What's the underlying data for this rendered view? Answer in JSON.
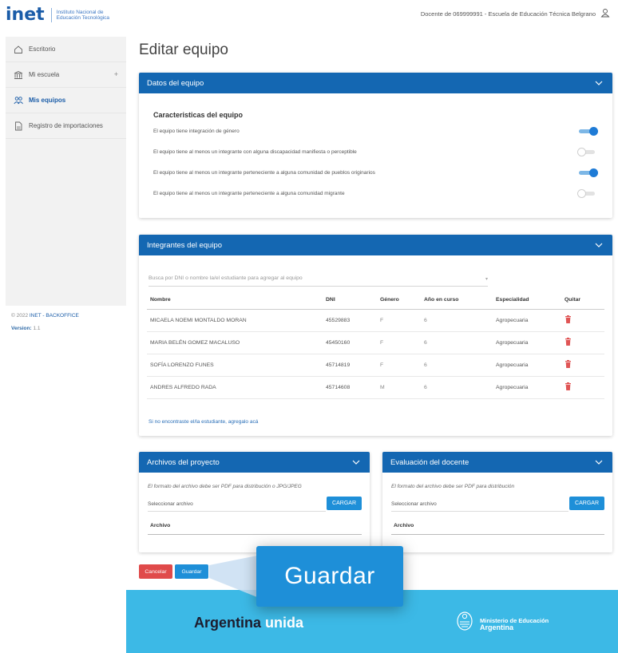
{
  "header": {
    "logo_word": "inet",
    "logo_sub_line1": "Instituto Nacional de",
    "logo_sub_line2": "Educación Tecnológica",
    "user_text": "Docente de 069999991 - Escuela de Educación Técnica Belgrano"
  },
  "sidebar": {
    "items": [
      {
        "label": "Escritorio",
        "icon": "home-icon"
      },
      {
        "label": "Mi escuela",
        "icon": "institution-icon",
        "expand": "+"
      },
      {
        "label": "Mis equipos",
        "icon": "team-icon",
        "active": true
      },
      {
        "label": "Registro de importaciones",
        "icon": "file-icon"
      }
    ],
    "footer_prefix": "© 2022 ",
    "footer_link": "INET - BACKOFFICE",
    "version_label": "Version:",
    "version_value": " 1.1"
  },
  "page": {
    "title": "Editar equipo"
  },
  "team_data": {
    "header": "Datos del equipo",
    "section_title": "Caracteristicas del equipo",
    "features": [
      {
        "label": "El equipo tiene integración de género",
        "enabled": true
      },
      {
        "label": "El equipo tiene al menos un integrante con alguna discapacidad manifiesta o perceptible",
        "enabled": false
      },
      {
        "label": "El equipo tiene al menos un integrante perteneciente a alguna comunidad de pueblos originarios",
        "enabled": true
      },
      {
        "label": "El equipo tiene al menos un integrante perteneciente a alguna comunidad migrante",
        "enabled": false
      }
    ]
  },
  "members": {
    "header": "Integrantes del equipo",
    "search_placeholder": "Busca por DNI o nombre la/el estudiante para agregar al equipo",
    "columns": [
      "Nombre",
      "DNI",
      "Género",
      "Año en curso",
      "Especialidad",
      "Quitar"
    ],
    "rows": [
      {
        "nombre": "MICAELA NOEMI MONTALDO MORAN",
        "dni": "45529883",
        "genero": "F",
        "anio": "6",
        "especialidad": "Agropecuaria"
      },
      {
        "nombre": "MARIA BELÉN GOMEZ MACALUSO",
        "dni": "45450160",
        "genero": "F",
        "anio": "6",
        "especialidad": "Agropecuaria"
      },
      {
        "nombre": "SOFÍA LORENZO FUNES",
        "dni": "45714819",
        "genero": "F",
        "anio": "6",
        "especialidad": "Agropecuaria"
      },
      {
        "nombre": "ANDRES ALFREDO RADA",
        "dni": "45714608",
        "genero": "M",
        "anio": "6",
        "especialidad": "Agropecuaria"
      }
    ],
    "add_link": "Si no encontraste el/la estudiante, agregalo acá"
  },
  "project_files": {
    "header": "Archivos del proyecto",
    "hint": "El formato del archivo debe ser PDF para distribución o JPG/JPEG",
    "file_label": "Seleccionar archivo",
    "button": "CARGAR",
    "column": "Archivo"
  },
  "teacher_eval": {
    "header": "Evaluación del docente",
    "hint": "El formato del archivo debe ser PDF para distribución",
    "file_label": "Seleccionar archivo",
    "button": "CARGAR",
    "column": "Archivo"
  },
  "actions": {
    "cancel": "Cancelar",
    "save": "Guardar",
    "callout": "Guardar"
  },
  "footer": {
    "slogan_main": "Argentina ",
    "slogan_accent": "unida",
    "ministry_line1": "Ministerio de Educación",
    "ministry_line2": "Argentina"
  },
  "colors": {
    "primary": "#1467b2",
    "accent": "#1e8fd8",
    "danger": "#e04a4a",
    "footer": "#3cb9e6"
  }
}
